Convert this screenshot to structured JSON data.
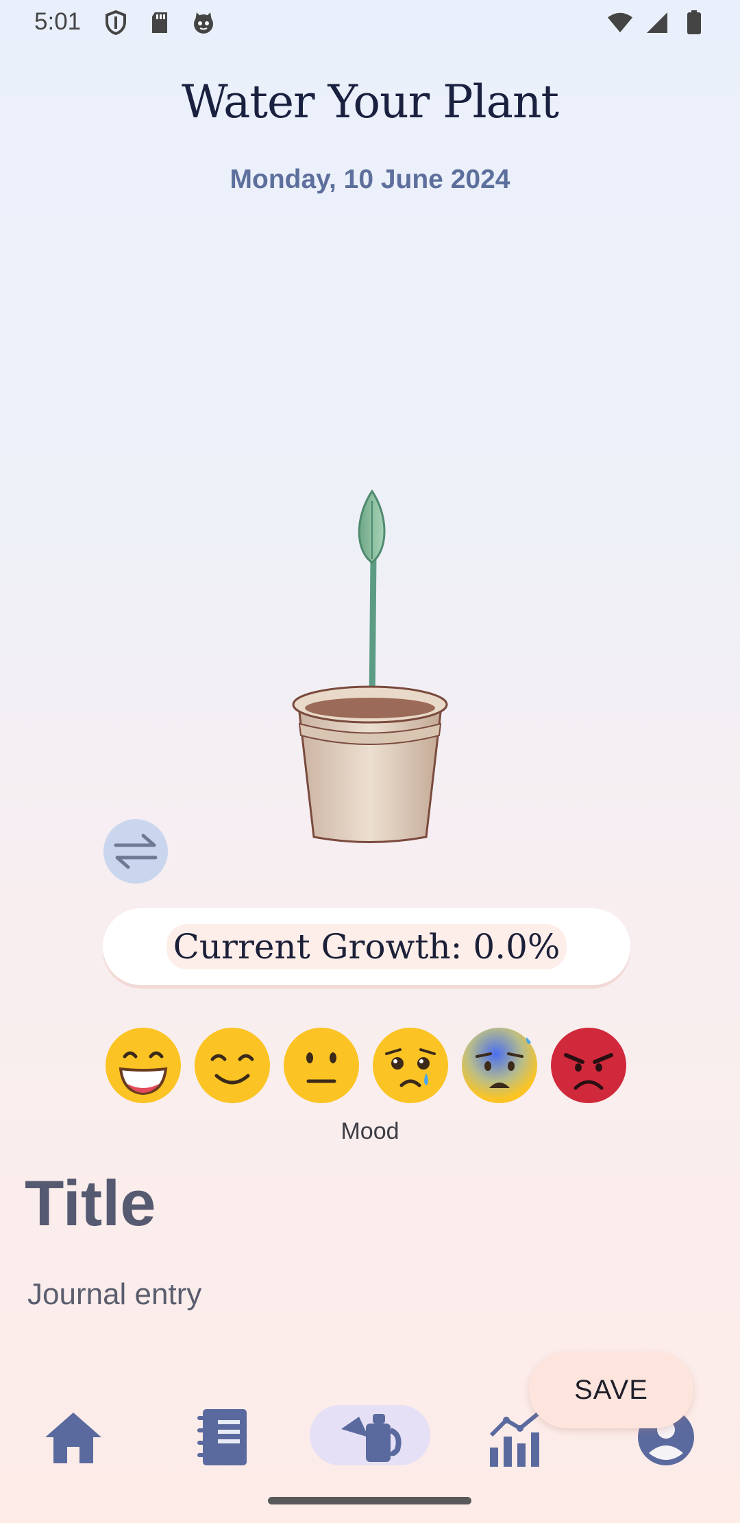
{
  "status_bar": {
    "time": "5:01"
  },
  "header": {
    "title": "Water Your Plant",
    "date": "Monday, 10 June 2024"
  },
  "growth": {
    "label": "Current Growth: 0.0%",
    "percent": 0.0
  },
  "mood": {
    "label": "Mood",
    "options": [
      "grinning-face-icon",
      "smiling-face-icon",
      "neutral-face-icon",
      "crying-face-icon",
      "anxious-sweat-face-icon",
      "angry-face-icon"
    ]
  },
  "journal": {
    "title_placeholder": "Title",
    "entry_placeholder": "Journal entry"
  },
  "actions": {
    "save_label": "SAVE"
  },
  "nav": {
    "items": [
      "home-icon",
      "journal-icon",
      "watering-can-icon",
      "stats-icon",
      "profile-icon"
    ],
    "active": 2
  },
  "colors": {
    "accent": "#5d6f9c",
    "nav_icon": "#5b6a9e",
    "nav_active_bg": "#e6e0f6",
    "save_bg": "#fde5dd"
  }
}
